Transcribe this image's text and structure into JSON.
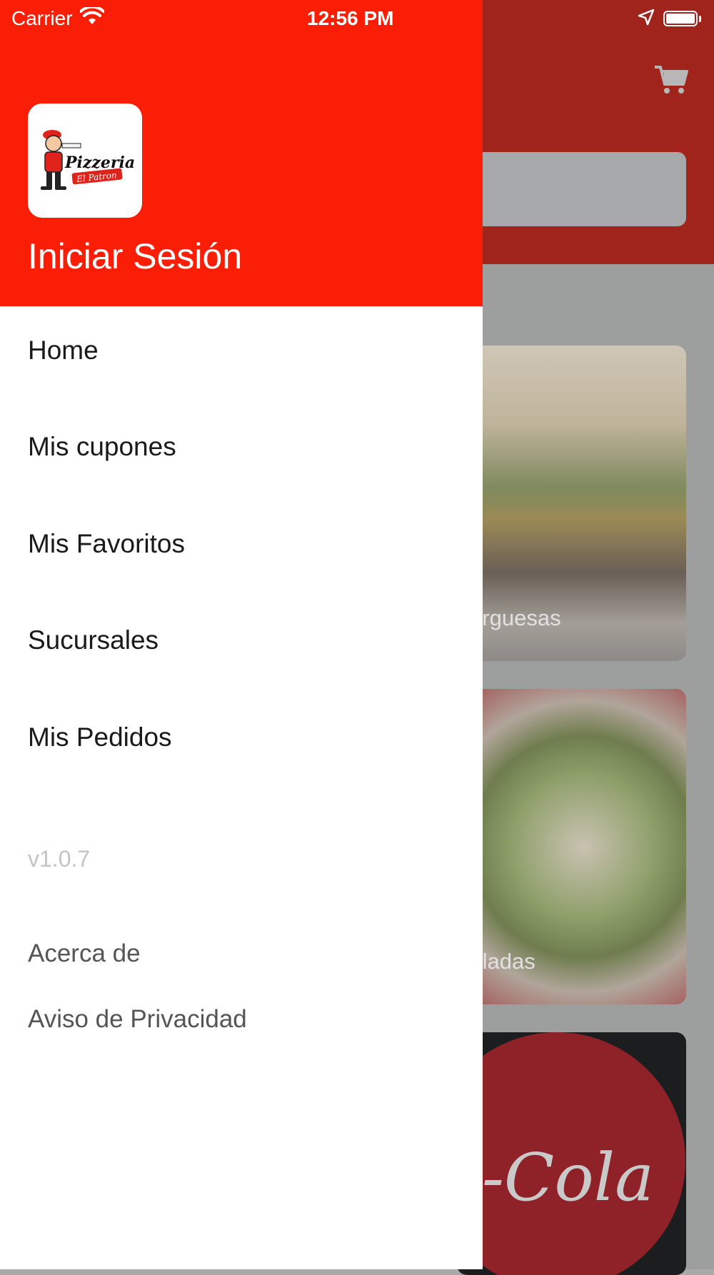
{
  "status_bar": {
    "carrier": "Carrier",
    "time": "12:56 PM"
  },
  "drawer": {
    "logo_text": "Pizzeria El Patron",
    "login_label": "Iniciar Sesión",
    "menu": [
      {
        "label": "Home"
      },
      {
        "label": "Mis cupones"
      },
      {
        "label": "Mis Favoritos"
      },
      {
        "label": "Sucursales"
      },
      {
        "label": "Mis Pedidos"
      }
    ],
    "version": "v1.0.7",
    "footer_links": [
      {
        "label": "Acerca de"
      },
      {
        "label": "Aviso de Privacidad"
      }
    ]
  },
  "background": {
    "categories": [
      {
        "label": "mburguesas"
      },
      {
        "label": "Ensaladas"
      },
      {
        "label": "a-Cola"
      }
    ]
  },
  "colors": {
    "drawer_header": "#fa1e07",
    "main_header_dimmed": "#a1241c",
    "text_dark": "#1a1a1a",
    "text_muted": "#555555",
    "version_text": "#c3c3c3"
  }
}
